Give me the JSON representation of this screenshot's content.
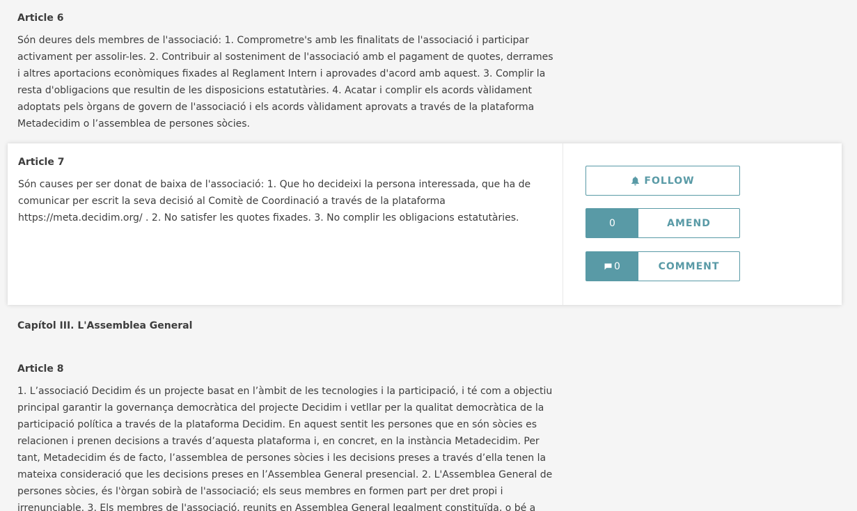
{
  "article6": {
    "title": "Article 6",
    "body": "Són deures dels membres de l'associació: 1. Comprometre's amb les finalitats de l'associació i participar activament per assolir-les. 2. Contribuir al sosteniment de l'associació amb el pagament de quotes, derrames i altres aportacions econòmiques fixades al Reglament Intern i aprovades d'acord amb aquest. 3. Complir la resta d'obligacions que resultin de les disposicions estatutàries. 4. Acatar i complir els acords vàlidament adoptats pels òrgans de govern de l'associació i els acords vàlidament aprovats a través de la plataforma Metadecidim o l’assemblea de persones sòcies."
  },
  "article7": {
    "title": "Article 7",
    "body": "Són causes per ser donat de baixa de l'associació: 1. Que ho decideixi la persona interessada, que ha de comunicar per escrit la seva decisió al Comitè de Coordinació a través de la plataforma https://meta.decidim.org/ . 2. No satisfer les quotes fixades. 3. No complir les obligacions estatutàries.",
    "actions": {
      "follow_label": "FOLLOW",
      "follow_icon": "bell-icon",
      "amend_count": "0",
      "amend_label": "AMEND",
      "comment_count": "0",
      "comment_icon": "comment-icon",
      "comment_label": "COMMENT"
    }
  },
  "chapter": {
    "title": "Capítol III. L'Assemblea General"
  },
  "article8": {
    "title": "Article 8",
    "body": "1. L’associació Decidim és un projecte basat en l’àmbit de les tecnologies i la participació, i té com a objectiu principal garantir la governança democràtica del projecte Decidim i vetllar per la qualitat democràtica de la participació política a través de la plataforma Decidim. En aquest sentit les persones que en són sòcies es relacionen i prenen decisions a través d’aquesta plataforma i, en concret, en la instància Metadecidim. Per tant, Metadecidim és de facto, l’assemblea de persones sòcies i les decisions preses a través d’ella tenen la mateixa consideració que les decisions preses en l’Assemblea General presencial. 2. L'Assemblea General de persones sòcies, és l'òrgan sobirà de l'associació; els seus membres en formen part per dret propi i irrenunciable. 3. Els membres de l'associació, reunits en Assemblea General legalment constituïda, o bé a través de la plataforma"
  },
  "colors": {
    "accent": "#599aa6",
    "background": "#f5f5f5",
    "card": "#ffffff",
    "text": "#3d3d3d"
  }
}
